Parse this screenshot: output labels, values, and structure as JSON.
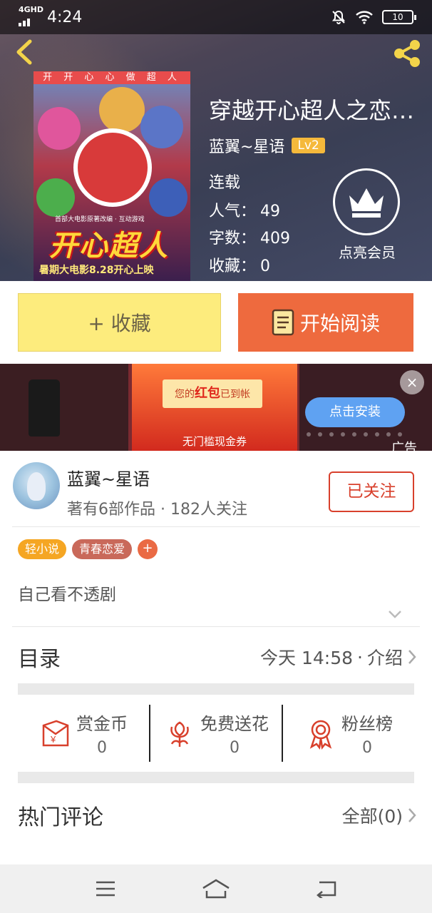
{
  "status_bar": {
    "network": "4GHD",
    "time": "4:24",
    "battery": "10"
  },
  "book": {
    "title": "穿越开心超人之恋…",
    "author": "蓝翼~星语",
    "level": "Lv2",
    "status": "连载",
    "popularity_label": "人气：",
    "popularity": "49",
    "words_label": "字数：",
    "words": "409",
    "favorites_label": "收藏：",
    "favorites": "0"
  },
  "cover": {
    "top_text": "开 开 心 心 做 超 人",
    "logo": "开心超人",
    "subtitle": "首部大电影原著改编 · 互动游戏",
    "release": "暑期大电影8.28开心上映"
  },
  "vip": {
    "label": "点亮会员"
  },
  "actions": {
    "collect": "+ 收藏",
    "read": "开始阅读"
  },
  "ad": {
    "message_prefix": "您的",
    "message_highlight": "红包",
    "message_suffix": "已到帐",
    "coupon": "无门槛现金券",
    "install": "点击安装",
    "close": "×",
    "label": "广告"
  },
  "author_card": {
    "name": "蓝翼~星语",
    "stats": "著有6部作品 · 182人关注",
    "follow": "已关注"
  },
  "tags": [
    "轻小说",
    "青春恋爱"
  ],
  "tag_add": "+",
  "intro": "自己看不透剧",
  "catalog": {
    "label": "目录",
    "updated": "今天 14:58",
    "sep": "·",
    "intro_link": "介绍"
  },
  "rewards": [
    {
      "name": "赏金币",
      "value": "0"
    },
    {
      "name": "免费送花",
      "value": "0"
    },
    {
      "name": "粉丝榜",
      "value": "0"
    }
  ],
  "comments": {
    "label": "热门评论",
    "all": "全部(0)"
  },
  "colors": {
    "accent": "#ee6a3e",
    "collect": "#fdec7d",
    "follow": "#d8402c",
    "tag_orange": "#f5a623",
    "tag_red": "#c9695a"
  }
}
